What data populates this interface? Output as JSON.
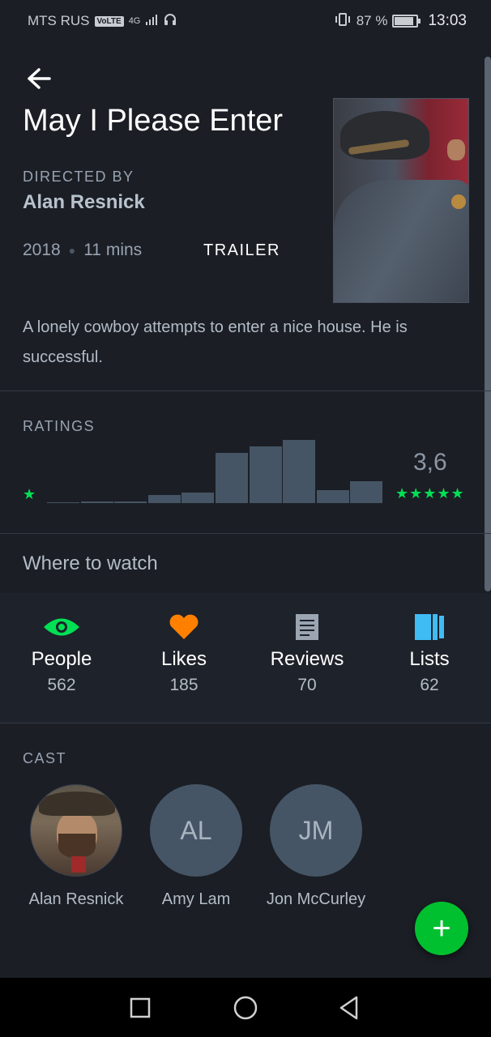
{
  "status_bar": {
    "carrier": "MTS RUS",
    "volte": "VoLTE",
    "network": "4G",
    "battery": "87 %",
    "battery_level": 0.87,
    "time": "13:03"
  },
  "film": {
    "title": "May I Please Enter",
    "directed_by_label": "DIRECTED BY",
    "director": "Alan Resnick",
    "year": "2018",
    "runtime": "11 mins",
    "trailer_label": "TRAILER",
    "synopsis": "A lonely cowboy attempts to enter a nice house. He is successful."
  },
  "ratings": {
    "label": "RATINGS",
    "average": "3,6",
    "min_stars": "★",
    "max_stars": "★★★★★",
    "distribution": [
      1,
      3,
      2,
      12,
      16,
      75,
      85,
      95,
      19,
      33
    ],
    "accent": "#00e054"
  },
  "where_to_watch": {
    "label": "Where to watch"
  },
  "stats": [
    {
      "label": "People",
      "count": "562",
      "icon": "eye-icon",
      "color": "#00e054"
    },
    {
      "label": "Likes",
      "count": "185",
      "icon": "heart-icon",
      "color": "#ff8000"
    },
    {
      "label": "Reviews",
      "count": "70",
      "icon": "document-icon",
      "color": "#9aa5b1"
    },
    {
      "label": "Lists",
      "count": "62",
      "icon": "lists-icon",
      "color": "#40bcf4"
    }
  ],
  "cast": {
    "label": "CAST",
    "members": [
      {
        "name": "Alan Resnick",
        "initials": ""
      },
      {
        "name": "Amy Lam",
        "initials": "AL"
      },
      {
        "name": "Jon McCurley",
        "initials": "JM"
      }
    ]
  },
  "fab": {
    "label": "+"
  }
}
